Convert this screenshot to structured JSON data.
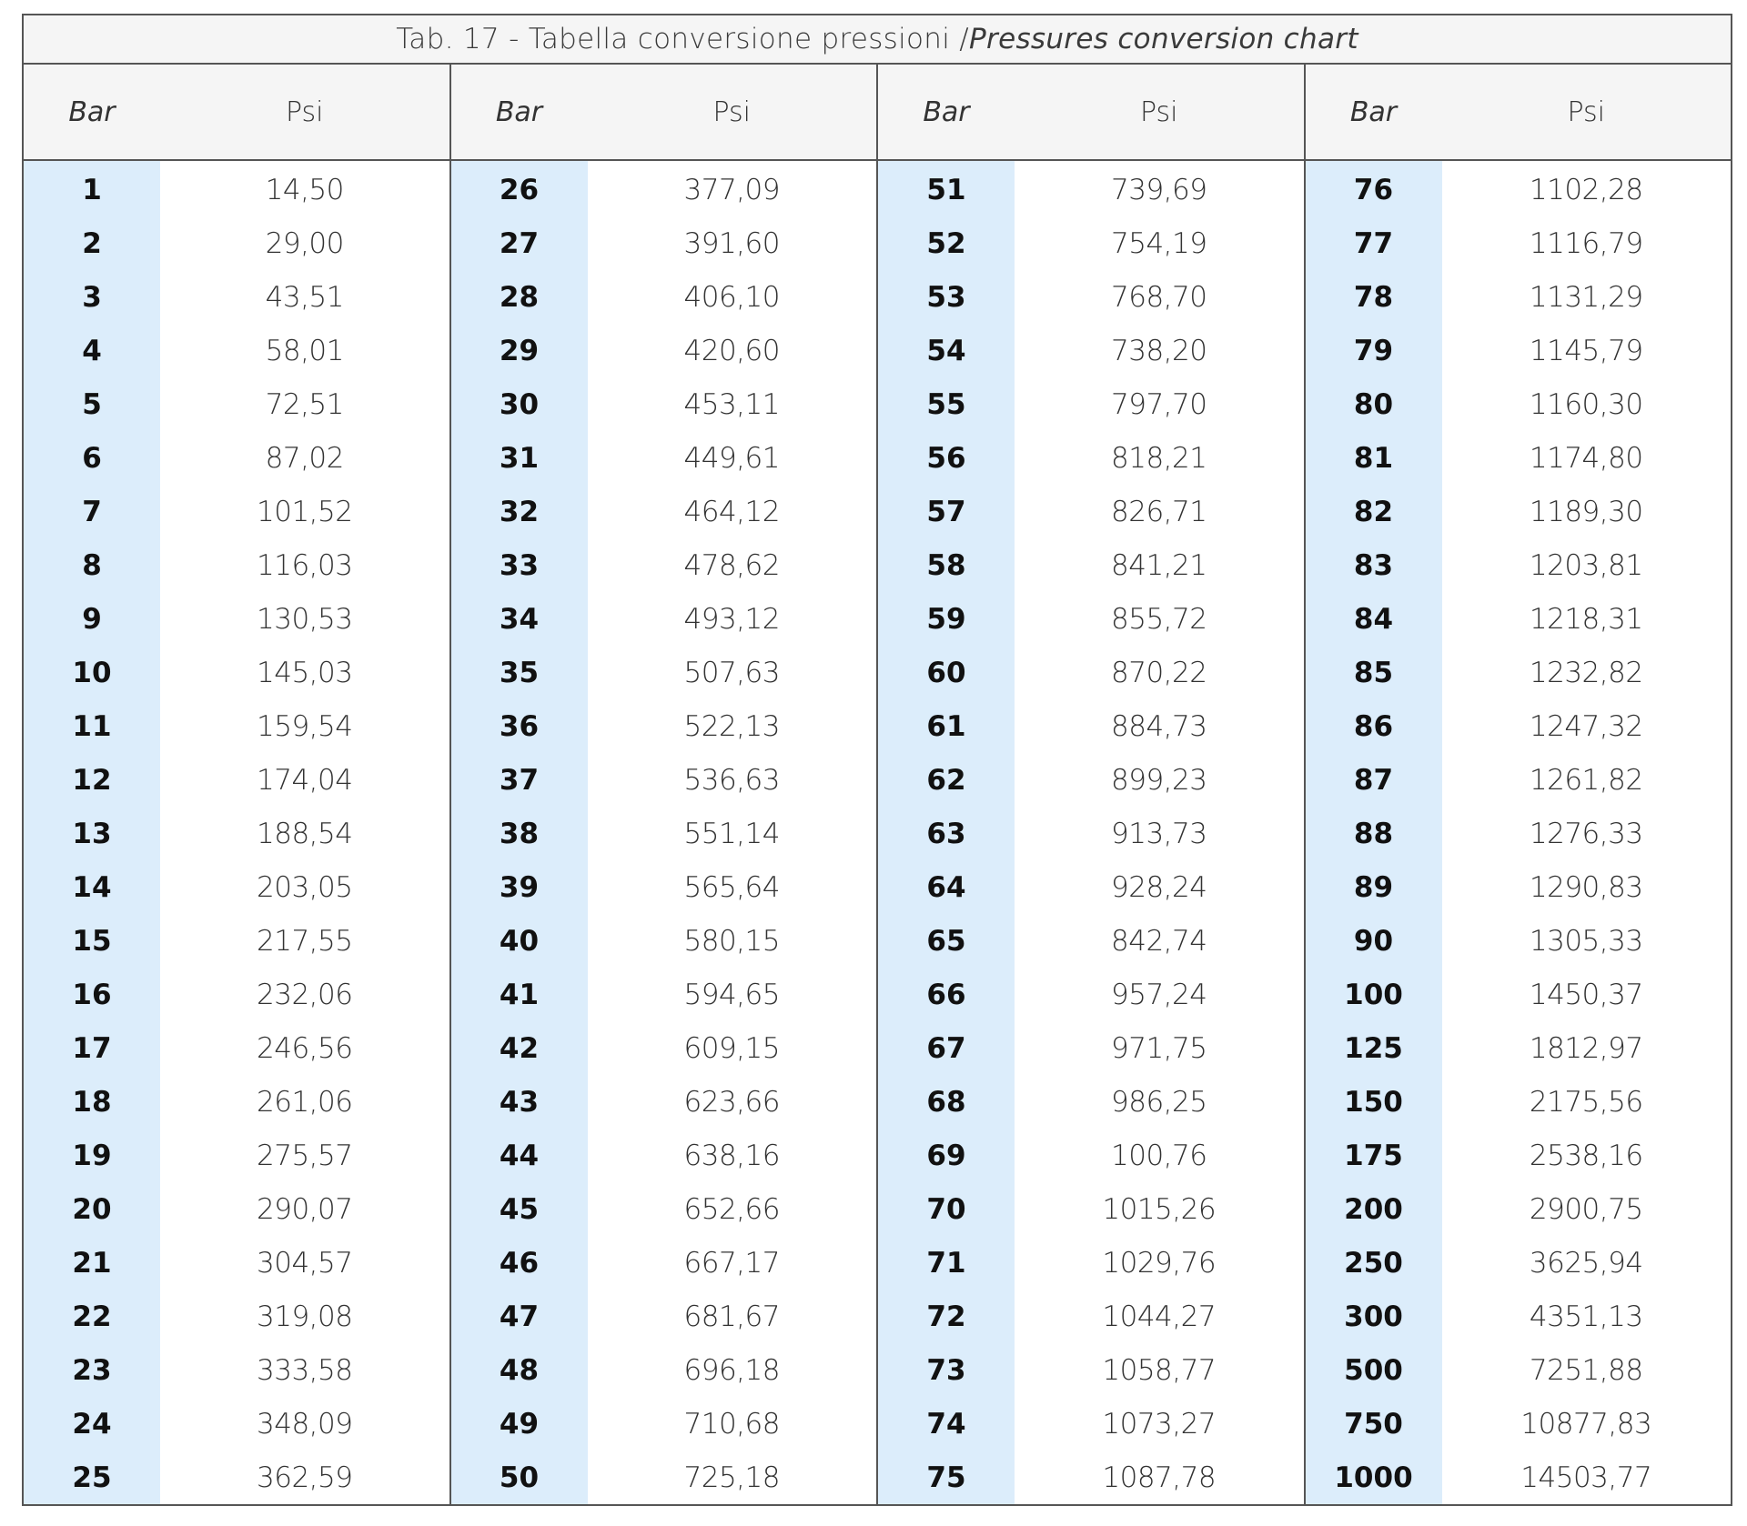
{
  "title": {
    "main": "Tab. 17 - Tabella conversione pressioni / ",
    "italic": "Pressures conversion chart"
  },
  "headers": {
    "bar": "Bar",
    "psi": "Psi"
  },
  "groups": [
    {
      "rows": [
        [
          "1",
          "14,50"
        ],
        [
          "2",
          "29,00"
        ],
        [
          "3",
          "43,51"
        ],
        [
          "4",
          "58,01"
        ],
        [
          "5",
          "72,51"
        ],
        [
          "6",
          "87,02"
        ],
        [
          "7",
          "101,52"
        ],
        [
          "8",
          "116,03"
        ],
        [
          "9",
          "130,53"
        ],
        [
          "10",
          "145,03"
        ],
        [
          "11",
          "159,54"
        ],
        [
          "12",
          "174,04"
        ],
        [
          "13",
          "188,54"
        ],
        [
          "14",
          "203,05"
        ],
        [
          "15",
          "217,55"
        ],
        [
          "16",
          "232,06"
        ],
        [
          "17",
          "246,56"
        ],
        [
          "18",
          "261,06"
        ],
        [
          "19",
          "275,57"
        ],
        [
          "20",
          "290,07"
        ],
        [
          "21",
          "304,57"
        ],
        [
          "22",
          "319,08"
        ],
        [
          "23",
          "333,58"
        ],
        [
          "24",
          "348,09"
        ],
        [
          "25",
          "362,59"
        ]
      ]
    },
    {
      "rows": [
        [
          "26",
          "377,09"
        ],
        [
          "27",
          "391,60"
        ],
        [
          "28",
          "406,10"
        ],
        [
          "29",
          "420,60"
        ],
        [
          "30",
          "453,11"
        ],
        [
          "31",
          "449,61"
        ],
        [
          "32",
          "464,12"
        ],
        [
          "33",
          "478,62"
        ],
        [
          "34",
          "493,12"
        ],
        [
          "35",
          "507,63"
        ],
        [
          "36",
          "522,13"
        ],
        [
          "37",
          "536,63"
        ],
        [
          "38",
          "551,14"
        ],
        [
          "39",
          "565,64"
        ],
        [
          "40",
          "580,15"
        ],
        [
          "41",
          "594,65"
        ],
        [
          "42",
          "609,15"
        ],
        [
          "43",
          "623,66"
        ],
        [
          "44",
          "638,16"
        ],
        [
          "45",
          "652,66"
        ],
        [
          "46",
          "667,17"
        ],
        [
          "47",
          "681,67"
        ],
        [
          "48",
          "696,18"
        ],
        [
          "49",
          "710,68"
        ],
        [
          "50",
          "725,18"
        ]
      ]
    },
    {
      "rows": [
        [
          "51",
          "739,69"
        ],
        [
          "52",
          "754,19"
        ],
        [
          "53",
          "768,70"
        ],
        [
          "54",
          "738,20"
        ],
        [
          "55",
          "797,70"
        ],
        [
          "56",
          "818,21"
        ],
        [
          "57",
          "826,71"
        ],
        [
          "58",
          "841,21"
        ],
        [
          "59",
          "855,72"
        ],
        [
          "60",
          "870,22"
        ],
        [
          "61",
          "884,73"
        ],
        [
          "62",
          "899,23"
        ],
        [
          "63",
          "913,73"
        ],
        [
          "64",
          "928,24"
        ],
        [
          "65",
          "842,74"
        ],
        [
          "66",
          "957,24"
        ],
        [
          "67",
          "971,75"
        ],
        [
          "68",
          "986,25"
        ],
        [
          "69",
          "100,76"
        ],
        [
          "70",
          "1015,26"
        ],
        [
          "71",
          "1029,76"
        ],
        [
          "72",
          "1044,27"
        ],
        [
          "73",
          "1058,77"
        ],
        [
          "74",
          "1073,27"
        ],
        [
          "75",
          "1087,78"
        ]
      ]
    },
    {
      "rows": [
        [
          "76",
          "1102,28"
        ],
        [
          "77",
          "1116,79"
        ],
        [
          "78",
          "1131,29"
        ],
        [
          "79",
          "1145,79"
        ],
        [
          "80",
          "1160,30"
        ],
        [
          "81",
          "1174,80"
        ],
        [
          "82",
          "1189,30"
        ],
        [
          "83",
          "1203,81"
        ],
        [
          "84",
          "1218,31"
        ],
        [
          "85",
          "1232,82"
        ],
        [
          "86",
          "1247,32"
        ],
        [
          "87",
          "1261,82"
        ],
        [
          "88",
          "1276,33"
        ],
        [
          "89",
          "1290,83"
        ],
        [
          "90",
          "1305,33"
        ],
        [
          "100",
          "1450,37"
        ],
        [
          "125",
          "1812,97"
        ],
        [
          "150",
          "2175,56"
        ],
        [
          "175",
          "2538,16"
        ],
        [
          "200",
          "2900,75"
        ],
        [
          "250",
          "3625,94"
        ],
        [
          "300",
          "4351,13"
        ],
        [
          "500",
          "7251,88"
        ],
        [
          "750",
          "10877,83"
        ],
        [
          "1000",
          "14503,77"
        ]
      ]
    }
  ],
  "colors": {
    "bar_column_bg": "#dcedfb",
    "header_bg": "#f5f5f5",
    "border": "#555555"
  }
}
